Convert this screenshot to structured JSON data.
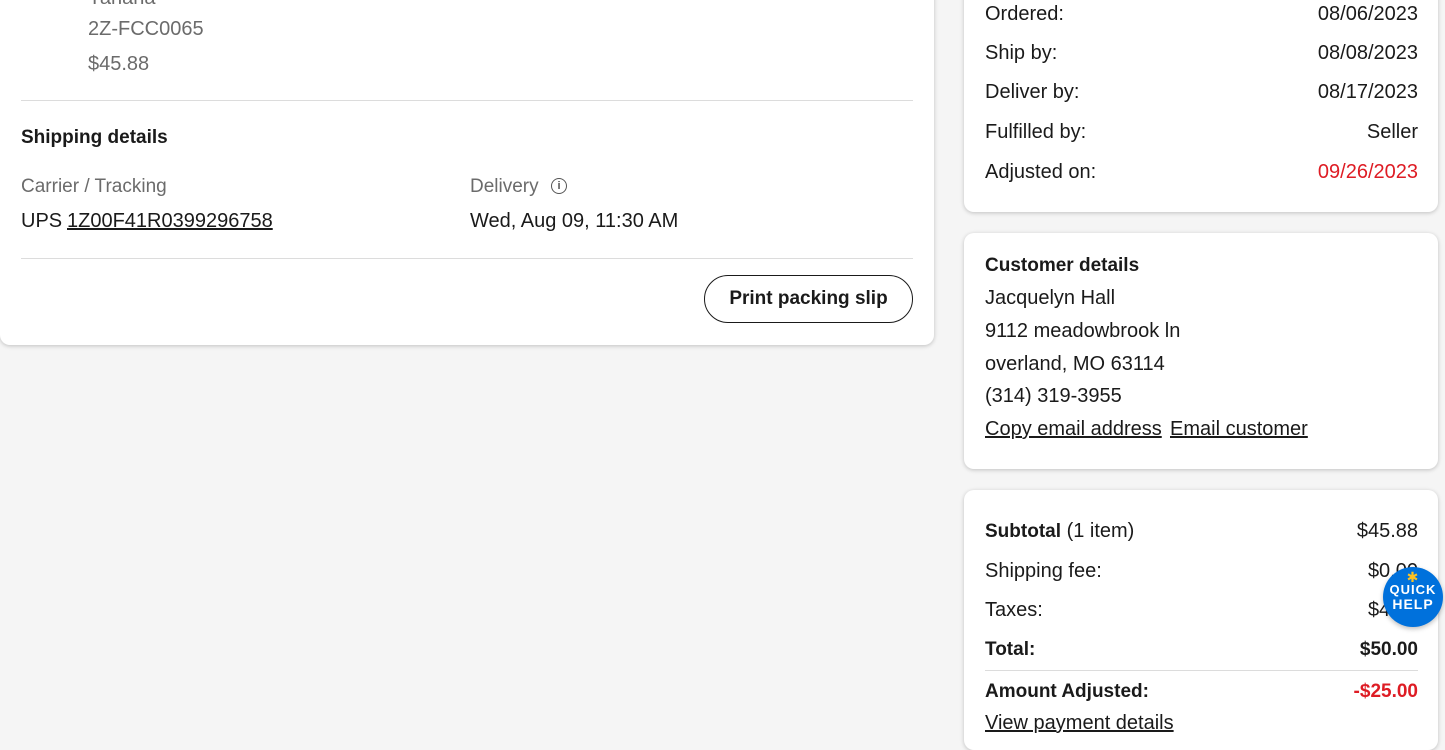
{
  "item": {
    "brand_partial": "Yahana",
    "sku": "2Z-FCC0065",
    "price": "$45.88"
  },
  "shipping": {
    "title": "Shipping details",
    "carrier_label": "Carrier / Tracking",
    "carrier": "UPS",
    "tracking_number": "1Z00F41R0399296758",
    "delivery_label": "Delivery",
    "delivery_value": "Wed, Aug 09, 11:30 AM",
    "print_button": "Print packing slip"
  },
  "dates": {
    "rows": [
      {
        "label": "Ordered:",
        "value": "08/06/2023"
      },
      {
        "label": "Ship by:",
        "value": "08/08/2023"
      },
      {
        "label": "Deliver by:",
        "value": "08/17/2023"
      },
      {
        "label": "Fulfilled by:",
        "value": "Seller"
      },
      {
        "label": "Adjusted on:",
        "value": "09/26/2023"
      }
    ]
  },
  "customer": {
    "title": "Customer details",
    "name": "Jacquelyn Hall",
    "address1": "9112 meadowbrook ln",
    "address2": "overland, MO 63114",
    "phone": "(314) 319-3955",
    "copy_email_link": "Copy email address",
    "email_customer_link": "Email customer"
  },
  "summary": {
    "subtotal_label": "Subtotal",
    "subtotal_count": "(1 item)",
    "subtotal_value": "$45.88",
    "shipping_label": "Shipping fee:",
    "shipping_value": "$0.00",
    "taxes_label": "Taxes:",
    "taxes_value": "$4.12",
    "total_label": "Total:",
    "total_value": "$50.00",
    "adjusted_label": "Amount Adjusted:",
    "adjusted_value": "-$25.00",
    "payment_link": "View payment details"
  },
  "quick_help": {
    "line1": "QUICK",
    "line2": "HELP",
    "accent": "#ffc220",
    "background": "#0071dc"
  },
  "colors": {
    "adjusted_red": "#de1c24",
    "text": "#1a1a1a",
    "muted": "#6b6b6b"
  }
}
